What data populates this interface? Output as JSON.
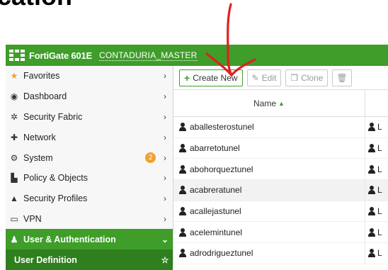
{
  "annotation": {
    "heading_fragment": "cation"
  },
  "header": {
    "product": "FortiGate 601E",
    "hostname": "CONTADURIA_MASTER"
  },
  "sidebar": {
    "items": [
      {
        "label": "Favorites",
        "icon": "star-icon"
      },
      {
        "label": "Dashboard",
        "icon": "dashboard-icon"
      },
      {
        "label": "Security Fabric",
        "icon": "security-fabric-icon"
      },
      {
        "label": "Network",
        "icon": "network-icon"
      },
      {
        "label": "System",
        "icon": "gear-icon",
        "badge": "2"
      },
      {
        "label": "Policy & Objects",
        "icon": "policy-icon"
      },
      {
        "label": "Security Profiles",
        "icon": "lock-icon"
      },
      {
        "label": "VPN",
        "icon": "monitor-icon"
      },
      {
        "label": "User & Authentication",
        "icon": "user-icon",
        "expanded": true
      },
      {
        "label": "User Definition",
        "icon": "",
        "favorite": "☆"
      }
    ]
  },
  "toolbar": {
    "create_new": "Create New",
    "edit": "Edit",
    "clone": "Clone"
  },
  "table": {
    "columns": [
      "Name"
    ],
    "type_fragment": "L",
    "rows": [
      "aballesterostunel",
      "abarretotunel",
      "abohorqueztunel",
      "acabreratunel",
      "acallejastunel",
      "acelemintunel",
      "adrodrigueztunel"
    ]
  },
  "colors": {
    "brand_green": "#3f9d2a",
    "annotation_red": "#e02020",
    "badge_orange": "#f0a030"
  }
}
